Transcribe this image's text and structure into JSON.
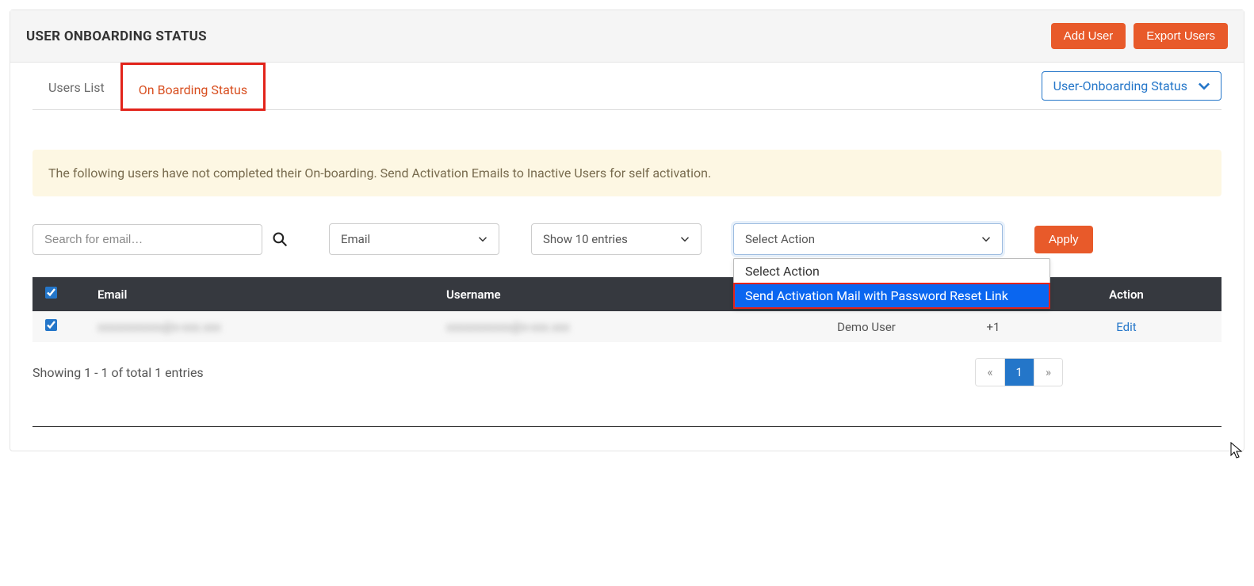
{
  "header": {
    "title": "USER ONBOARDING STATUS",
    "add_user": "Add User",
    "export_users": "Export Users"
  },
  "tabs": {
    "users_list": "Users List",
    "onboarding_status": "On Boarding Status"
  },
  "status_filter": {
    "label": "User-Onboarding Status"
  },
  "banner": {
    "text": "The following users have not completed their On-boarding. Send Activation Emails to Inactive Users for self activation."
  },
  "controls": {
    "search_placeholder": "Search for email…",
    "filter_field": "Email",
    "entries": "Show 10 entries",
    "select_action": "Select Action",
    "action_options": {
      "opt0": "Select Action",
      "opt1": "Send Activation Mail with Password Reset Link"
    },
    "apply": "Apply"
  },
  "table": {
    "columns": {
      "email": "Email",
      "username": "Username",
      "action": "Action"
    },
    "rows": [
      {
        "email": "xxxxxxxxxxx@x-xxx.xxx",
        "username": "xxxxxxxxxxx@x-xxx.xxx",
        "role": "Demo User",
        "count": "+1",
        "action": "Edit"
      }
    ]
  },
  "footer": {
    "summary": "Showing 1 - 1 of total 1 entries",
    "prev": "«",
    "page1": "1",
    "next": "»"
  }
}
